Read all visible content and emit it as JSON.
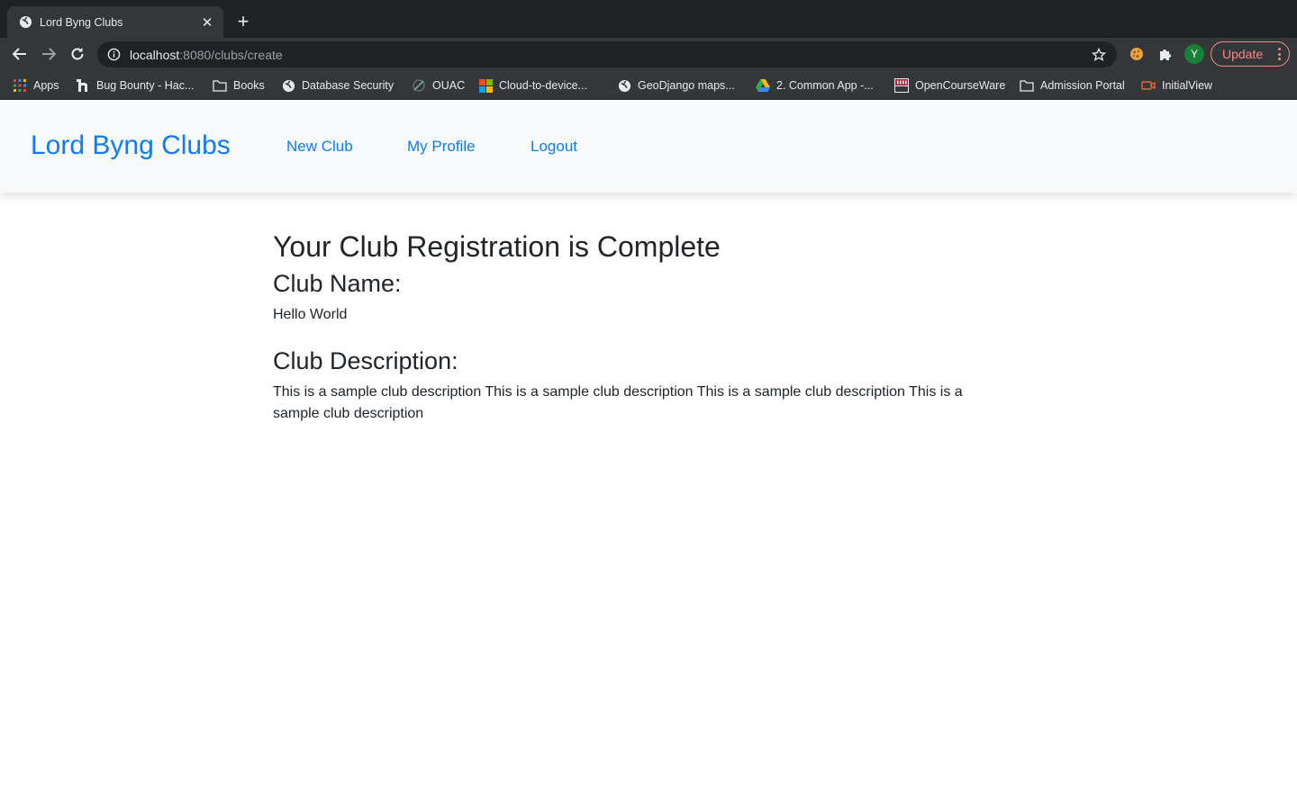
{
  "browser": {
    "tab": {
      "title": "Lord Byng Clubs",
      "favicon": "globe-icon"
    },
    "address": {
      "host": "localhost",
      "path": ":8080/clubs/create"
    },
    "profile_initial": "Y",
    "update_label": "Update",
    "bookmarks": [
      {
        "label": "Apps",
        "icon": "apps-grid-icon"
      },
      {
        "label": "Bug Bounty - Hac...",
        "icon": "hackerone-icon"
      },
      {
        "label": "Books",
        "icon": "folder-icon"
      },
      {
        "label": "Database Security",
        "icon": "globe-icon"
      },
      {
        "label": "OUAC",
        "icon": "ouac-icon"
      },
      {
        "label": "Cloud-to-device...",
        "icon": "microsoft-icon"
      },
      {
        "label": "GeoDjango maps...",
        "icon": "globe-icon"
      },
      {
        "label": "2. Common App -...",
        "icon": "google-drive-icon"
      },
      {
        "label": "OpenCourseWare",
        "icon": "mit-ocw-icon"
      },
      {
        "label": "Admission Portal",
        "icon": "folder-icon"
      },
      {
        "label": "InitialView",
        "icon": "initialview-icon"
      }
    ]
  },
  "navbar": {
    "brand": "Lord Byng Clubs",
    "links": [
      "New Club",
      "My Profile",
      "Logout"
    ]
  },
  "content": {
    "heading": "Your Club Registration is Complete",
    "name_label": "Club Name:",
    "name_value": "Hello World",
    "description_label": "Club Description:",
    "description_value": "This is a sample club description This is a sample club description This is a sample club description This is a sample club description"
  },
  "colors": {
    "link": "#0d7bf2",
    "navbar_bg": "#f8f9fa",
    "text": "#212529",
    "chrome_dark": "#202124",
    "chrome_toolbar": "#35363a"
  }
}
